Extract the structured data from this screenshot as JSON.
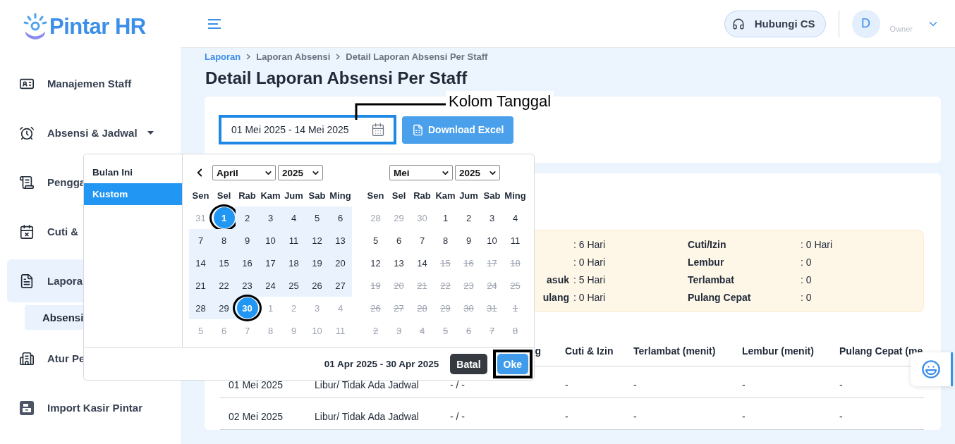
{
  "sidebar": {
    "logo": "Pintar HR",
    "items": [
      {
        "label": "Manajemen Staff",
        "caret": false,
        "selected": false
      },
      {
        "label": "Absensi & Jadwal",
        "caret": true,
        "selected": false
      },
      {
        "label": "Pengga",
        "caret": false,
        "selected": false
      },
      {
        "label": "Cuti &",
        "caret": false,
        "selected": false
      },
      {
        "label": "Lapora",
        "caret": false,
        "selected": true,
        "children": [
          {
            "label": "Absensi",
            "selected": true
          }
        ]
      },
      {
        "label": "Atur Pe",
        "caret": false,
        "selected": false
      },
      {
        "label": "Import Kasir Pintar",
        "caret": false,
        "selected": false
      }
    ]
  },
  "header": {
    "support_button": "Hubungi CS",
    "avatar": "D",
    "role": "Owner"
  },
  "breadcrumb": [
    {
      "label": "Laporan",
      "link": true
    },
    {
      "label": "Laporan Absensi",
      "link": false
    },
    {
      "label": "Detail Laporan Absensi Per Staff",
      "link": false
    }
  ],
  "title": "Detail Laporan Absensi Per Staff",
  "filter": {
    "date_range": "01 Mei 2025 - 14 Mei 2025",
    "highlighted": true,
    "download_button": "Download Excel",
    "callout": "Kolom Tanggal"
  },
  "picker": {
    "presets": [
      {
        "label": "Bulan Ini",
        "selected": false
      },
      {
        "label": "Kustom",
        "selected": true
      }
    ],
    "calendars": [
      {
        "month": "April",
        "year": "2025",
        "show_prev": true,
        "weekdays": [
          "Sen",
          "Sel",
          "Rab",
          "Kam",
          "Jum",
          "Sab",
          "Ming"
        ],
        "weeks": [
          [
            {
              "day": "31",
              "kind": "outside"
            },
            {
              "day": "1",
              "kind": "start"
            },
            {
              "day": "2",
              "kind": "range"
            },
            {
              "day": "3",
              "kind": "range"
            },
            {
              "day": "4",
              "kind": "range"
            },
            {
              "day": "5",
              "kind": "range"
            },
            {
              "day": "6",
              "kind": "range"
            }
          ],
          [
            {
              "day": "7",
              "kind": "range"
            },
            {
              "day": "8",
              "kind": "range"
            },
            {
              "day": "9",
              "kind": "range"
            },
            {
              "day": "10",
              "kind": "range"
            },
            {
              "day": "11",
              "kind": "range"
            },
            {
              "day": "12",
              "kind": "range"
            },
            {
              "day": "13",
              "kind": "range"
            }
          ],
          [
            {
              "day": "14",
              "kind": "range"
            },
            {
              "day": "15",
              "kind": "range"
            },
            {
              "day": "16",
              "kind": "range"
            },
            {
              "day": "17",
              "kind": "range"
            },
            {
              "day": "18",
              "kind": "range"
            },
            {
              "day": "19",
              "kind": "range"
            },
            {
              "day": "20",
              "kind": "range"
            }
          ],
          [
            {
              "day": "21",
              "kind": "range"
            },
            {
              "day": "22",
              "kind": "range"
            },
            {
              "day": "23",
              "kind": "range"
            },
            {
              "day": "24",
              "kind": "range"
            },
            {
              "day": "25",
              "kind": "range"
            },
            {
              "day": "26",
              "kind": "range"
            },
            {
              "day": "27",
              "kind": "range"
            }
          ],
          [
            {
              "day": "28",
              "kind": "range"
            },
            {
              "day": "29",
              "kind": "range"
            },
            {
              "day": "30",
              "kind": "end"
            },
            {
              "day": "1",
              "kind": "outside"
            },
            {
              "day": "2",
              "kind": "outside"
            },
            {
              "day": "3",
              "kind": "outside"
            },
            {
              "day": "4",
              "kind": "outside"
            }
          ],
          [
            {
              "day": "5",
              "kind": "outside"
            },
            {
              "day": "6",
              "kind": "outside"
            },
            {
              "day": "7",
              "kind": "outside"
            },
            {
              "day": "8",
              "kind": "outside"
            },
            {
              "day": "9",
              "kind": "outside"
            },
            {
              "day": "10",
              "kind": "outside"
            },
            {
              "day": "11",
              "kind": "outside"
            }
          ]
        ]
      },
      {
        "month": "Mei",
        "year": "2025",
        "show_prev": false,
        "weekdays": [
          "Sen",
          "Sel",
          "Rab",
          "Kam",
          "Jum",
          "Sab",
          "Ming"
        ],
        "weeks": [
          [
            {
              "day": "28",
              "kind": "outside"
            },
            {
              "day": "29",
              "kind": "outside"
            },
            {
              "day": "30",
              "kind": "outside"
            },
            {
              "day": "1",
              "kind": "normal"
            },
            {
              "day": "2",
              "kind": "normal"
            },
            {
              "day": "3",
              "kind": "normal"
            },
            {
              "day": "4",
              "kind": "normal"
            }
          ],
          [
            {
              "day": "5",
              "kind": "normal"
            },
            {
              "day": "6",
              "kind": "normal"
            },
            {
              "day": "7",
              "kind": "normal"
            },
            {
              "day": "8",
              "kind": "normal"
            },
            {
              "day": "9",
              "kind": "normal"
            },
            {
              "day": "10",
              "kind": "normal"
            },
            {
              "day": "11",
              "kind": "normal"
            }
          ],
          [
            {
              "day": "12",
              "kind": "normal"
            },
            {
              "day": "13",
              "kind": "normal"
            },
            {
              "day": "14",
              "kind": "normal"
            },
            {
              "day": "15",
              "kind": "disabled"
            },
            {
              "day": "16",
              "kind": "disabled"
            },
            {
              "day": "17",
              "kind": "disabled"
            },
            {
              "day": "18",
              "kind": "disabled"
            }
          ],
          [
            {
              "day": "19",
              "kind": "disabled"
            },
            {
              "day": "20",
              "kind": "disabled"
            },
            {
              "day": "21",
              "kind": "disabled"
            },
            {
              "day": "22",
              "kind": "disabled"
            },
            {
              "day": "23",
              "kind": "disabled"
            },
            {
              "day": "24",
              "kind": "disabled"
            },
            {
              "day": "25",
              "kind": "disabled"
            }
          ],
          [
            {
              "day": "26",
              "kind": "disabled"
            },
            {
              "day": "27",
              "kind": "disabled"
            },
            {
              "day": "28",
              "kind": "disabled"
            },
            {
              "day": "29",
              "kind": "disabled"
            },
            {
              "day": "30",
              "kind": "disabled"
            },
            {
              "day": "31",
              "kind": "disabled"
            },
            {
              "day": "1",
              "kind": "disabled"
            }
          ],
          [
            {
              "day": "2",
              "kind": "disabled"
            },
            {
              "day": "3",
              "kind": "disabled"
            },
            {
              "day": "4",
              "kind": "disabled"
            },
            {
              "day": "5",
              "kind": "disabled"
            },
            {
              "day": "6",
              "kind": "disabled"
            },
            {
              "day": "7",
              "kind": "disabled"
            },
            {
              "day": "8",
              "kind": "disabled"
            }
          ]
        ]
      }
    ],
    "range": "01 Apr 2025 - 30 Apr 2025",
    "buttons": [
      {
        "label": "Batal",
        "kind": "cancel",
        "framed": false
      },
      {
        "label": "Oke",
        "kind": "confirm",
        "framed": true
      }
    ]
  },
  "summary": {
    "left": [
      {
        "value": ": 6 Hari"
      },
      {
        "value": ": 0 Hari"
      },
      {
        "label": "asuk",
        "value": ": 5 Hari"
      },
      {
        "label": "ulang",
        "value": ": 0 Hari"
      }
    ],
    "right": [
      {
        "label": "Cuti/Izin",
        "value": ": 0 Hari"
      },
      {
        "label": "Lembur",
        "value": ": 0"
      },
      {
        "label": "Terlambat",
        "value": ": 0"
      },
      {
        "label": "Pulang Cepat",
        "value": ": 0"
      }
    ]
  },
  "table": {
    "columns": [
      "",
      "",
      "g",
      "Cuti & Izin",
      "Terlambat (menit)",
      "Lembur (menit)",
      "Pulang Cepat (me"
    ],
    "rows": [
      [
        "01 Mei 2025",
        "Libur/ Tidak Ada Jadwal",
        "- / -",
        "-",
        "-",
        "-",
        "-"
      ],
      [
        "02 Mei 2025",
        "Libur/ Tidak Ada Jadwal",
        "- / -",
        "-",
        "-",
        "-",
        "-"
      ]
    ]
  }
}
